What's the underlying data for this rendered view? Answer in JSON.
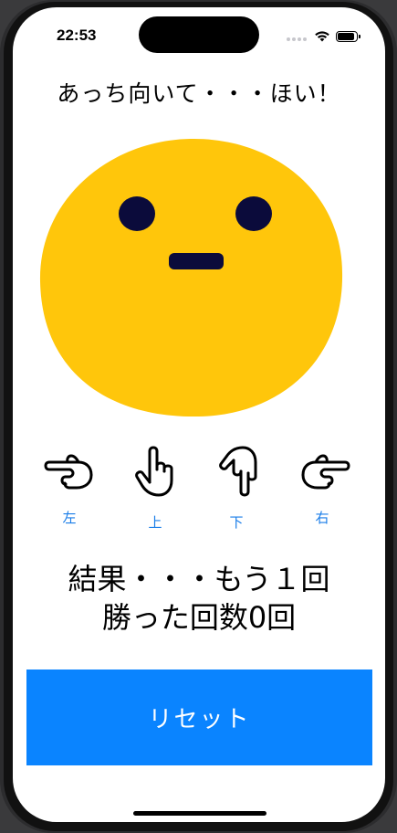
{
  "status_bar": {
    "time": "22:53"
  },
  "title": "あっち向いて・・・ほい！",
  "face": {
    "color": "#FFC60B",
    "feature_color": "#0B0B3B"
  },
  "directions": [
    {
      "label": "左",
      "icon": "hand-pointing-left-icon"
    },
    {
      "label": "上",
      "icon": "hand-pointing-up-icon"
    },
    {
      "label": "下",
      "icon": "hand-pointing-down-icon"
    },
    {
      "label": "右",
      "icon": "hand-pointing-right-icon"
    }
  ],
  "result": {
    "line1": "結果・・・もう１回",
    "line2": "勝った回数0回"
  },
  "reset_button": {
    "label": "リセット",
    "color": "#0A84FF"
  }
}
